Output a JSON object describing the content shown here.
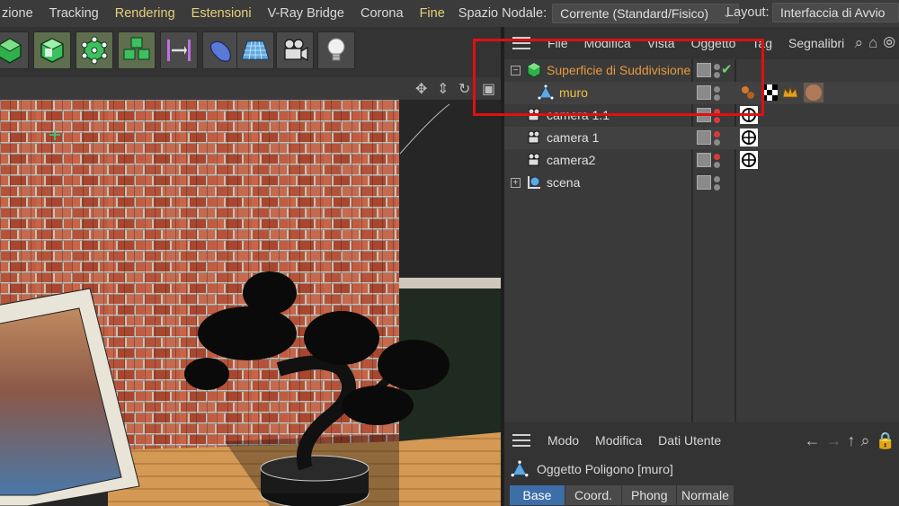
{
  "menubar": {
    "items": [
      {
        "label": "zione",
        "highlight": false
      },
      {
        "label": "Tracking",
        "highlight": false
      },
      {
        "label": "Rendering",
        "highlight": true
      },
      {
        "label": "Estensioni",
        "highlight": true
      },
      {
        "label": "V-Ray Bridge",
        "highlight": false
      },
      {
        "label": "Corona",
        "highlight": false
      },
      {
        "label": "Fine",
        "highlight": true
      }
    ],
    "node_space_label": "Spazio Nodale:",
    "node_space_value": "Corrente (Standard/Fisico)",
    "layout_label": "Layout:",
    "layout_value": "Interfaccia di Avvio"
  },
  "toolbar": {
    "buttons": [
      {
        "name": "subdivision-surface-icon",
        "active": false
      },
      {
        "name": "extrude-cube-icon",
        "active": true
      },
      {
        "name": "polygon-points-icon",
        "active": true
      },
      {
        "name": "array-cubes-icon",
        "active": true
      },
      {
        "name": "align-arrow-icon",
        "active": false
      },
      {
        "name": "deformer-icon",
        "active": false
      },
      {
        "name": "floor-plane-icon",
        "active": false
      },
      {
        "name": "camera-icon",
        "active": false
      },
      {
        "name": "light-bulb-icon",
        "active": false
      }
    ]
  },
  "object_manager": {
    "menus": [
      "File",
      "Modifica",
      "Vista",
      "Oggetto",
      "Tag",
      "Segnalibri"
    ],
    "objects": [
      {
        "name": "Superficie di Suddivisione",
        "icon": "subdivision-object-icon",
        "style": "orange",
        "expand": "−",
        "indent": 0
      },
      {
        "name": "muro",
        "icon": "polygon-object-icon",
        "style": "selected",
        "expand": "",
        "indent": 1
      },
      {
        "name": "camera 1.1",
        "icon": "camera-object-icon",
        "style": "normal",
        "expand": "",
        "indent": 0
      },
      {
        "name": "camera 1",
        "icon": "camera-object-icon",
        "style": "normal",
        "expand": "",
        "indent": 0
      },
      {
        "name": "camera2",
        "icon": "camera-object-icon",
        "style": "normal",
        "expand": "",
        "indent": 0
      },
      {
        "name": "scena",
        "icon": "null-object-icon",
        "style": "normal",
        "expand": "+",
        "indent": 0
      }
    ]
  },
  "attribute_manager": {
    "menus": [
      "Modo",
      "Modifica",
      "Dati Utente"
    ],
    "title": "Oggetto Poligono [muro]",
    "tabs": [
      {
        "label": "Base",
        "active": true
      },
      {
        "label": "Coord.",
        "active": false
      },
      {
        "label": "Phong",
        "active": false
      },
      {
        "label": "Normale",
        "active": false
      }
    ]
  },
  "colors": {
    "accent_orange": "#e89a3c",
    "accent_yellow": "#f0c040",
    "highlight_red": "#e01010",
    "tab_active_blue": "#3d6ea8"
  }
}
